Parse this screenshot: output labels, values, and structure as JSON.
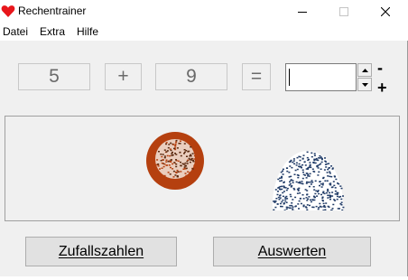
{
  "window": {
    "title": "Rechentrainer",
    "icon": "heart-icon",
    "controls": [
      "minimize-icon",
      "maximize-icon",
      "close-icon"
    ]
  },
  "menu": {
    "items": [
      {
        "label": "Datei"
      },
      {
        "label": "Extra"
      },
      {
        "label": "Hilfe"
      }
    ]
  },
  "exercise": {
    "operand1": "5",
    "operator": "+",
    "operand2": "9",
    "equals": "=",
    "answer": "",
    "spin_up_icon": "triangle-up-icon",
    "spin_down_icon": "triangle-down-icon",
    "minus_label": "-",
    "plus_label": "+"
  },
  "feedback_panel": {
    "images": [
      {
        "name": "red-firework-icon",
        "color": "#b5400f"
      },
      {
        "name": "blue-firework-icon",
        "color": "#1f3a66"
      }
    ]
  },
  "buttons": {
    "random": {
      "label": "Zufallszahlen",
      "underline": "Z"
    },
    "evaluate": {
      "label": "Auswerten",
      "underline": "A"
    }
  },
  "colors": {
    "heart": "#e8161b",
    "window_bg": "#f0f0f0",
    "number_text": "#6a6a6a"
  }
}
